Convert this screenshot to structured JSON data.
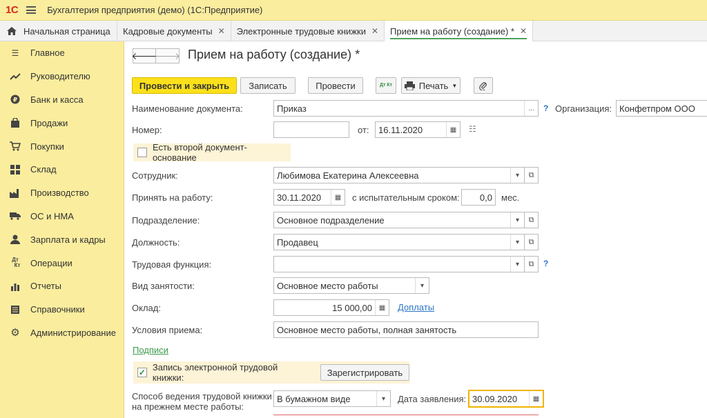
{
  "app": {
    "logo": "1С",
    "title": "Бухгалтерия предприятия (демо)  (1С:Предприятие)"
  },
  "tabs": [
    {
      "label": "Начальная страница"
    },
    {
      "label": "Кадровые документы"
    },
    {
      "label": "Электронные трудовые книжки"
    },
    {
      "label": "Прием на работу (создание) *"
    }
  ],
  "sidebar": {
    "items": [
      {
        "label": "Главное",
        "icon": "menu-lines-icon"
      },
      {
        "label": "Руководителю",
        "icon": "trend-icon"
      },
      {
        "label": "Банк и касса",
        "icon": "ruble-coin-icon"
      },
      {
        "label": "Продажи",
        "icon": "bag-icon"
      },
      {
        "label": "Покупки",
        "icon": "cart-icon"
      },
      {
        "label": "Склад",
        "icon": "warehouse-grid-icon"
      },
      {
        "label": "Производство",
        "icon": "factory-icon"
      },
      {
        "label": "ОС и НМА",
        "icon": "truck-icon"
      },
      {
        "label": "Зарплата и кадры",
        "icon": "person-icon"
      },
      {
        "label": "Операции",
        "icon": "dt-kt-icon"
      },
      {
        "label": "Отчеты",
        "icon": "bar-chart-icon"
      },
      {
        "label": "Справочники",
        "icon": "book-icon"
      },
      {
        "label": "Администрирование",
        "icon": "gear-icon"
      }
    ]
  },
  "doc": {
    "title": "Прием на работу (создание) *"
  },
  "toolbar": {
    "post_close": "Провести и закрыть",
    "save": "Записать",
    "post": "Провести",
    "print": "Печать",
    "dtkt": "Дт Кт"
  },
  "form": {
    "doc_name_label": "Наименование документа:",
    "doc_name_value": "Приказ",
    "org_label": "Организация:",
    "org_value": "Конфетпром ООО",
    "number_label": "Номер:",
    "number_value": "",
    "from_label": "от:",
    "date_value": "16.11.2020",
    "second_doc_label": "Есть второй документ-основание",
    "employee_label": "Сотрудник:",
    "employee_value": "Любимова Екатерина Алексеевна",
    "hire_label": "Принять на работу:",
    "hire_date": "30.11.2020",
    "probation_label": "с испытательным сроком:",
    "probation_value": "0,0",
    "probation_unit": "мес.",
    "dept_label": "Подразделение:",
    "dept_value": "Основное подразделение",
    "position_label": "Должность:",
    "position_value": "Продавец",
    "labor_func_label": "Трудовая функция:",
    "labor_func_value": "",
    "employment_label": "Вид занятости:",
    "employment_value": "Основное место работы",
    "salary_label": "Оклад:",
    "salary_value": "15 000,00",
    "payments_link": "Доплаты",
    "conditions_label": "Условия приема:",
    "conditions_value": "Основное место работы, полная занятость",
    "signatures_link": "Подписи",
    "etk_label": "Запись электронной трудовой книжки:",
    "etk_checked": "✓",
    "register_button": "Зарегистрировать",
    "method_label_1": "Способ ведения трудовой книжки",
    "method_label_2": "на прежнем месте работы:",
    "method_value": "В бумажном виде",
    "app_date_label": "Дата заявления:",
    "app_date_value": "30.09.2020",
    "help": "?"
  },
  "colors": {
    "accent_yellow": "#fbed9e",
    "primary_button": "#fbe01b",
    "link_blue": "#2b76c8",
    "link_green": "#3a9a4a"
  }
}
